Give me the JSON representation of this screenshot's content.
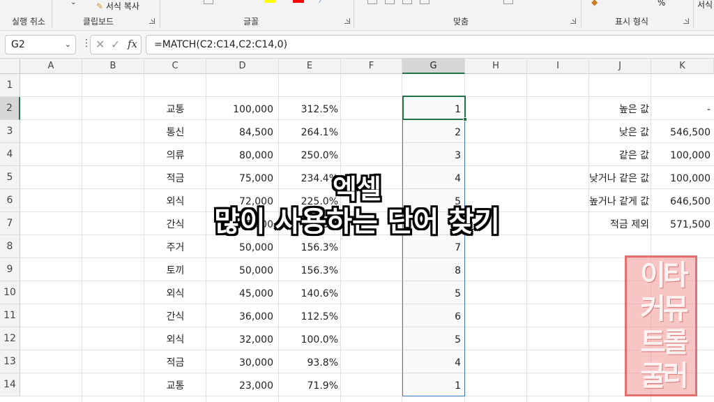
{
  "ribbon": {
    "undo_group": "실행 취소",
    "clipboard_group": "클립보드",
    "format_painter": "서식 복사",
    "font_group": "글꼴",
    "align_group": "맞춤",
    "number_group": "표시 형식",
    "right_btn": "서식",
    "percent_glyph": "%",
    "font_color": "#ff0000",
    "highlight_color": "#ffff00"
  },
  "formula_bar": {
    "name_box": "G2",
    "cancel_glyph": "✕",
    "enter_glyph": "✓",
    "fx_label": "fx",
    "formula": "=MATCH(C2:C14,C2:C14,0)"
  },
  "sheet": {
    "columns": [
      "A",
      "B",
      "C",
      "D",
      "E",
      "F",
      "G",
      "H",
      "I",
      "J",
      "K"
    ],
    "selected_column": "G",
    "rows": [
      "1",
      "2",
      "3",
      "4",
      "5",
      "6",
      "7",
      "8",
      "9",
      "10",
      "11",
      "12",
      "13",
      "14"
    ],
    "selected_row": "2",
    "table": [
      {
        "c": "교통",
        "d": "100,000",
        "e": "312.5%",
        "g": "1"
      },
      {
        "c": "통신",
        "d": "84,500",
        "e": "264.1%",
        "g": "2"
      },
      {
        "c": "의류",
        "d": "80,000",
        "e": "250.0%",
        "g": "3"
      },
      {
        "c": "적금",
        "d": "75,000",
        "e": "234.4%",
        "g": "4"
      },
      {
        "c": "외식",
        "d": "72,000",
        "e": "225.0%",
        "g": "5"
      },
      {
        "c": "간식",
        "d": "60,000",
        "e": "187.5%",
        "g": "6"
      },
      {
        "c": "주거",
        "d": "50,000",
        "e": "156.3%",
        "g": "7"
      },
      {
        "c": "토끼",
        "d": "50,000",
        "e": "156.3%",
        "g": "8"
      },
      {
        "c": "외식",
        "d": "45,000",
        "e": "140.6%",
        "g": "5"
      },
      {
        "c": "간식",
        "d": "36,000",
        "e": "112.5%",
        "g": "6"
      },
      {
        "c": "외식",
        "d": "32,000",
        "e": "100.0%",
        "g": "5"
      },
      {
        "c": "적금",
        "d": "30,000",
        "e": "93.8%",
        "g": "4"
      },
      {
        "c": "교통",
        "d": "23,000",
        "e": "71.9%",
        "g": "1"
      }
    ],
    "summary": [
      {
        "label": "높은 값",
        "value": "-"
      },
      {
        "label": "낮은 값",
        "value": "546,500"
      },
      {
        "label": "같은 값",
        "value": "100,000"
      },
      {
        "label": "낮거나 같은 값",
        "value": "100,000"
      },
      {
        "label": "높거나 같게 값",
        "value": "646,500"
      },
      {
        "label": "적금 제외",
        "value": "571,500"
      }
    ]
  },
  "overlay": {
    "line1": "엑셀",
    "line2": "많이 사용하는 단어 찾기"
  },
  "seal": {
    "row1": "이타",
    "row2": "커뮤",
    "row3": "트롤",
    "row4": "굴러"
  }
}
